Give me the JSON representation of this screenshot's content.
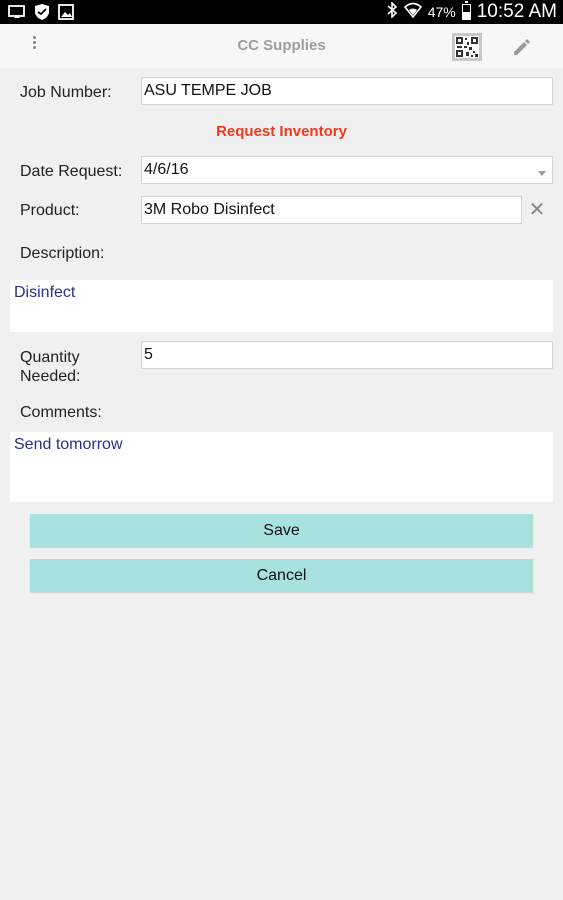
{
  "status_bar": {
    "battery_percent": "47%",
    "battery_level": 0.47,
    "time": "10:52 AM",
    "icons": [
      "cast-icon",
      "shield-icon",
      "image-icon",
      "bluetooth-icon",
      "wifi-icon",
      "battery-icon"
    ]
  },
  "app_bar": {
    "title": "CC Supplies",
    "icons": [
      "overflow-menu-icon",
      "qr-code-icon",
      "pencil-icon"
    ]
  },
  "form": {
    "job_number_label": "Job Number:",
    "job_number_value": "ASU TEMPE JOB",
    "section_heading": "Request Inventory",
    "date_label": "Date Request:",
    "date_value": "4/6/16",
    "product_label": "Product:",
    "product_value": "3M Robo Disinfect",
    "description_label": "Description:",
    "description_value": "Disinfect",
    "quantity_label_line1": "Quantity",
    "quantity_label_line2": "Needed:",
    "quantity_value": "5",
    "comments_label": "Comments:",
    "comments_value": "Send tomorrow",
    "clear_glyph": "✕"
  },
  "buttons": {
    "save": "Save",
    "cancel": "Cancel"
  },
  "colors": {
    "heading": "#f0391c",
    "button_bg": "#a8e2df",
    "textarea_text": "#2a2f8c"
  }
}
